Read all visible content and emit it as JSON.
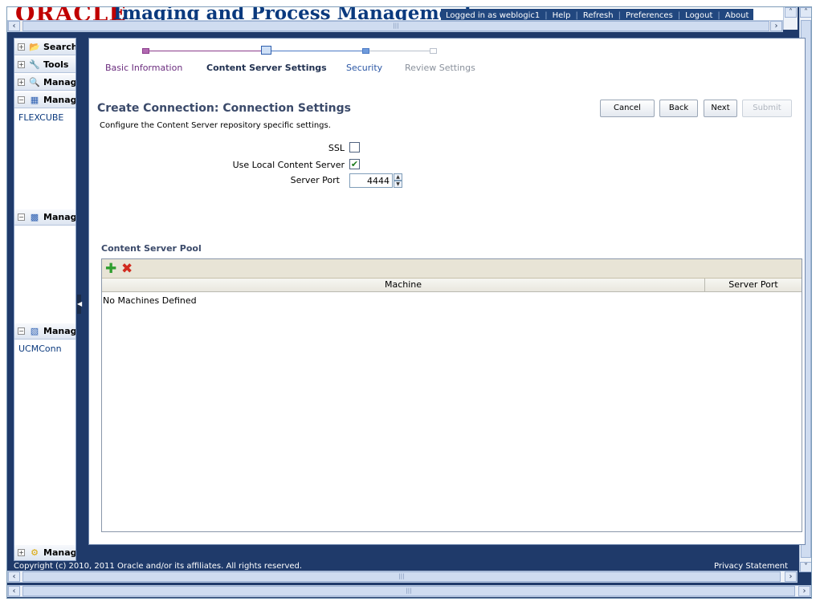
{
  "header": {
    "logo": "ORACLE",
    "app_title": "Imaging and Process Management",
    "links": [
      "Logged in as weblogic1",
      "Help",
      "Refresh",
      "Preferences",
      "Logout",
      "About"
    ]
  },
  "sidebar": {
    "sections": [
      {
        "label": "Searches",
        "toggle": "+",
        "icon": "folder-search-icon"
      },
      {
        "label": "Tools",
        "toggle": "+",
        "icon": "wrench-icon"
      },
      {
        "label": "Manage Searches",
        "toggle": "+",
        "icon": "magnifier-icon"
      },
      {
        "label": "Manage Applications",
        "toggle": "−",
        "icon": "application-icon"
      },
      {
        "label": "Manage Inputs",
        "toggle": "−",
        "icon": "input-icon"
      },
      {
        "label": "Manage Connections",
        "toggle": "−",
        "icon": "connection-icon"
      },
      {
        "label": "Manage Security",
        "toggle": "+",
        "icon": "key-icon"
      }
    ],
    "items": {
      "applications": [
        "FLEXCUBE"
      ],
      "connections": [
        "UCMConn"
      ]
    }
  },
  "train": {
    "steps": [
      "Basic Information",
      "Content Server Settings",
      "Security",
      "Review Settings"
    ],
    "current": 1
  },
  "page": {
    "title": "Create Connection: Connection Settings",
    "instruction": "Configure the Content Server repository specific settings."
  },
  "buttons": {
    "cancel": "Cancel",
    "back": "Back",
    "next": "Next",
    "submit": "Submit"
  },
  "form": {
    "ssl_label": "SSL",
    "ssl_checked": false,
    "local_label": "Use Local Content Server",
    "local_checked": true,
    "port_label": "Server Port",
    "port_value": "4444"
  },
  "pool": {
    "title": "Content Server Pool",
    "columns": [
      "Machine",
      "Server Port"
    ],
    "empty": "No Machines Defined",
    "add_icon": "add-icon",
    "delete_icon": "delete-icon"
  },
  "footer": {
    "copyright": "Copyright (c) 2010, 2011 Oracle and/or its affiliates. All rights reserved.",
    "privacy": "Privacy Statement"
  },
  "colors": {
    "frame_bg": "#1f3a6a",
    "title_blue": "#0b3a7e",
    "logo_red": "#c00000",
    "visited_step": "#8b3c8b",
    "current_step": "#4a79c4"
  }
}
